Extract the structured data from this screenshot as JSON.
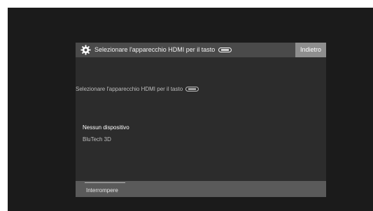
{
  "header": {
    "title": "Selezionare l'apparecchio HDMI per il tasto",
    "settings_icon": "gear-icon",
    "remote_key_icon": "hdmi-remote-key-icon",
    "back_label": "Indietro"
  },
  "body": {
    "prompt": "Selezionare l'apparecchio HDMI per il tasto",
    "options": [
      {
        "label": "Nessun dispositivo",
        "selected": true
      },
      {
        "label": "BluTech 3D",
        "selected": false
      }
    ]
  },
  "footer": {
    "cancel_label": "Interrompere"
  },
  "colors": {
    "screen_background": "#1b1b1b",
    "header_background": "#4a4a4a",
    "body_background": "#2c2c2c",
    "footer_background": "#5a5a5a",
    "back_button_background": "#8e8e8e"
  }
}
